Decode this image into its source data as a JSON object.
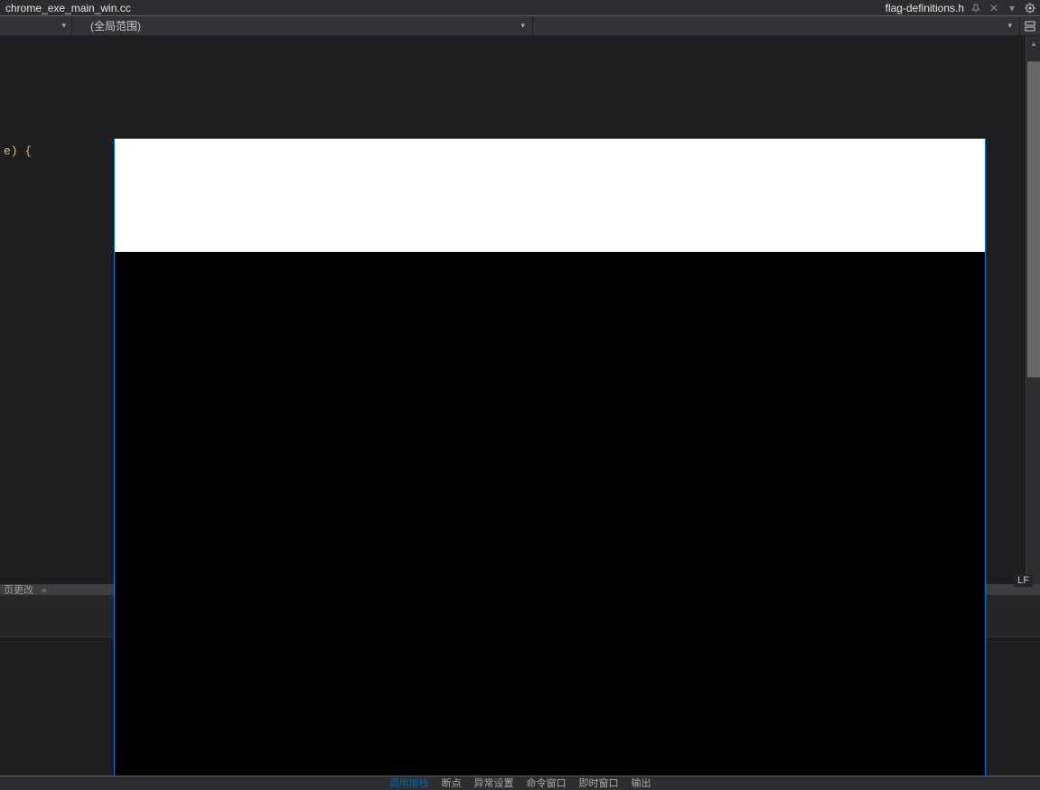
{
  "tabs": {
    "left_file": "chrome_exe_main_win.cc",
    "right_file": "flag-definitions.h"
  },
  "scope": {
    "label": "(全局范围)"
  },
  "code": {
    "fragment": "e) {"
  },
  "status": {
    "pending_changes": "页更改",
    "line_ending": "LF"
  },
  "bottom": {
    "callstack": "调用堆栈",
    "breakpoints": "断点",
    "exception_settings": "异常设置",
    "command_window": "命令窗口",
    "immediate_window": "即时窗口",
    "output": "输出"
  }
}
